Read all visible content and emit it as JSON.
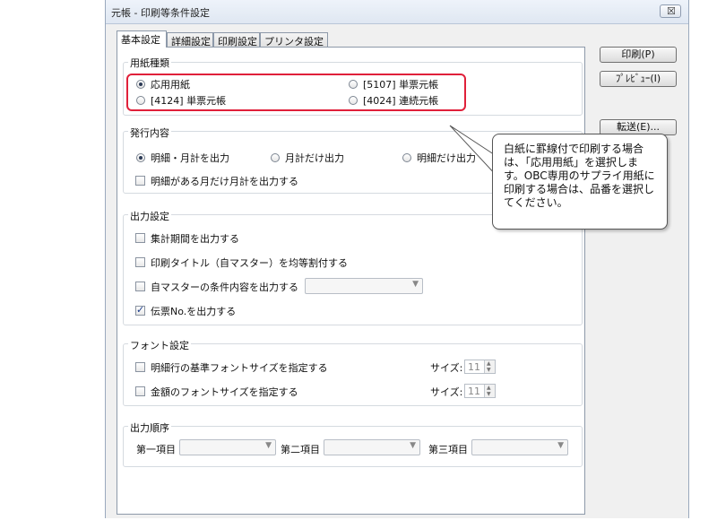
{
  "window": {
    "title": "元帳 - 印刷等条件設定",
    "close_label": "☒"
  },
  "tabs": [
    "基本設定",
    "詳細設定",
    "印刷設定",
    "プリンタ設定"
  ],
  "side_buttons": {
    "print": "印刷(P)",
    "preview": "ﾌﾟﾚﾋﾞｭｰ(I)",
    "transfer": "転送(E)..."
  },
  "paper": {
    "title": "用紙種類",
    "options": [
      "応用用紙",
      "[5107] 単票元帳",
      "[4124] 単票元帳",
      "[4024] 連続元帳"
    ],
    "selected": "応用用紙"
  },
  "issue": {
    "title": "発行内容",
    "options": [
      "明細・月計を出力",
      "月計だけ出力",
      "明細だけ出力"
    ],
    "selected": "明細・月計を出力",
    "checkbox": {
      "label": "明細がある月だけ月計を出力する",
      "checked": false
    }
  },
  "output": {
    "title": "出力設定",
    "items": [
      {
        "label": "集計期間を出力する",
        "checked": false
      },
      {
        "label": "印刷タイトル（自マスター）を均等割付する",
        "checked": false
      },
      {
        "label": "自マスターの条件内容を出力する",
        "checked": false
      },
      {
        "label": "伝票No.を出力する",
        "checked": true
      }
    ]
  },
  "font": {
    "title": "フォント設定",
    "items": [
      {
        "label": "明細行の基準フォントサイズを指定する",
        "checked": false,
        "size_label": "サイズ:",
        "size": "11"
      },
      {
        "label": "金額のフォントサイズを指定する",
        "checked": false,
        "size_label": "サイズ:",
        "size": "11"
      }
    ]
  },
  "order": {
    "title": "出力順序",
    "labels": [
      "第一項目",
      "第二項目",
      "第三項目"
    ]
  },
  "callout": {
    "text": "白紙に罫線付で印刷する場合は、「応用用紙」を選択します。OBC専用のサプライ用紙に印刷する場合は、品番を選択してください。"
  },
  "colors": {
    "highlight": "#e0203a",
    "accent": "#2b3a55"
  }
}
